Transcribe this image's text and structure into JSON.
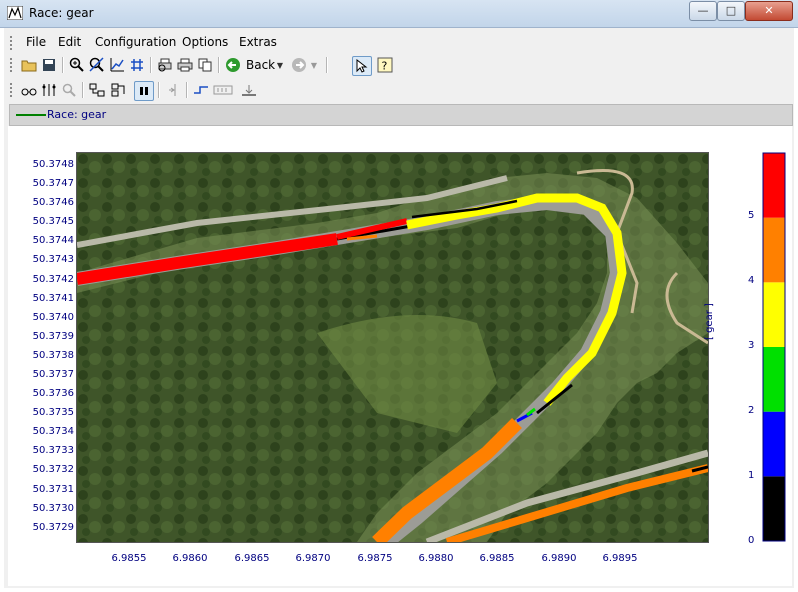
{
  "window": {
    "title": "Race: gear",
    "minimize": "—",
    "maximize": "□",
    "close": "✕"
  },
  "menu": [
    "File",
    "Edit",
    "Configuration",
    "Options",
    "Extras"
  ],
  "toolbar": {
    "back_label": "Back"
  },
  "legend": {
    "series_label": "Race: gear",
    "line_color": "#008000"
  },
  "chart_data": {
    "type": "scatter",
    "xlim": [
      6.985,
      6.99
    ],
    "ylim": [
      50.37285,
      50.37486
    ],
    "x_ticks": [
      "6.9855",
      "6.9860",
      "6.9865",
      "6.9870",
      "6.9875",
      "6.9880",
      "6.9885",
      "6.9890",
      "6.9895"
    ],
    "y_ticks": [
      "50.3748",
      "50.3747",
      "50.3746",
      "50.3745",
      "50.3744",
      "50.3743",
      "50.3742",
      "50.3741",
      "50.3740",
      "50.3739",
      "50.3738",
      "50.3737",
      "50.3736",
      "50.3735",
      "50.3734",
      "50.3733",
      "50.3732",
      "50.3731",
      "50.3730",
      "50.3729"
    ],
    "colorbar": {
      "label": "[ gear ]",
      "ticks": [
        "5",
        "4",
        "3",
        "2",
        "1",
        "0"
      ],
      "range": [
        0,
        6
      ],
      "bands": [
        {
          "from": 0,
          "to": 1,
          "color": "#000000"
        },
        {
          "from": 1,
          "to": 2,
          "color": "#0000ff"
        },
        {
          "from": 2,
          "to": 3,
          "color": "#00e000"
        },
        {
          "from": 3,
          "to": 4,
          "color": "#ffff00"
        },
        {
          "from": 4,
          "to": 5,
          "color": "#ff8000"
        },
        {
          "from": 5,
          "to": 6,
          "color": "#ff0000"
        }
      ]
    },
    "background": "satellite-map"
  }
}
